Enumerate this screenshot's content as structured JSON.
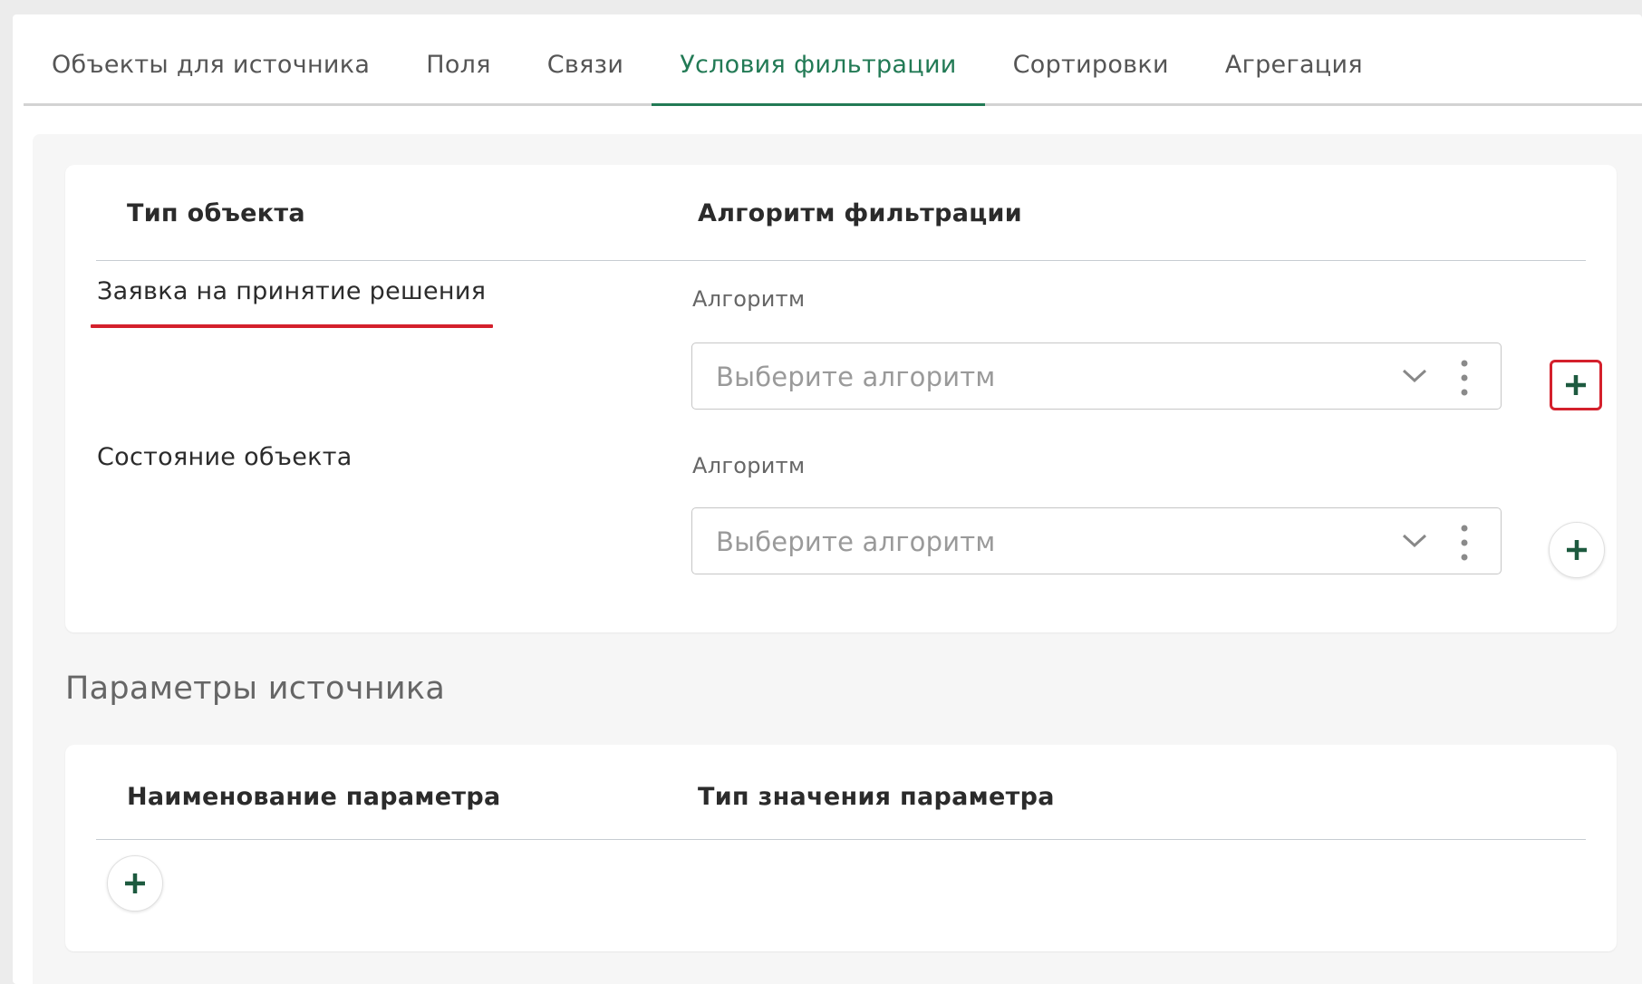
{
  "tabs": [
    {
      "label": "Объекты для источника",
      "active": false
    },
    {
      "label": "Поля",
      "active": false
    },
    {
      "label": "Связи",
      "active": false
    },
    {
      "label": "Условия фильтрации",
      "active": true
    },
    {
      "label": "Сортировки",
      "active": false
    },
    {
      "label": "Агрегация",
      "active": false
    }
  ],
  "filter_table": {
    "col_object_type": "Тип объекта",
    "col_algorithm": "Алгоритм фильтрации",
    "rows": [
      {
        "object_type": "Заявка на принятие решения",
        "field_label": "Алгоритм",
        "placeholder": "Выберите алгоритм",
        "highlighted": true
      },
      {
        "object_type": "Состояние объекта",
        "field_label": "Алгоритм",
        "placeholder": "Выберите алгоритм",
        "highlighted": false
      }
    ]
  },
  "params": {
    "section_title": "Параметры источника",
    "col_name": "Наименование параметра",
    "col_type": "Тип значения параметра"
  },
  "colors": {
    "accent": "#227a55",
    "highlight": "#d4202c"
  },
  "icons": {
    "add": "plus-icon",
    "dropdown": "chevron-down-icon",
    "menu": "vertical-dots-icon"
  }
}
